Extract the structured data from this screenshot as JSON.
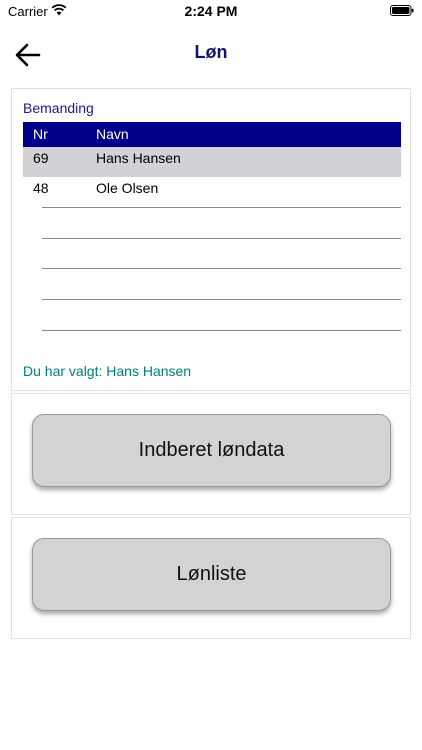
{
  "status_bar": {
    "carrier": "Carrier",
    "time": "2:24 PM",
    "wifi_icon": "wifi-icon",
    "battery_icon": "battery-icon"
  },
  "nav": {
    "title": "Løn",
    "back_icon": "arrow-left-icon"
  },
  "crew": {
    "label": "Bemanding",
    "columns": [
      "Nr",
      "Navn"
    ],
    "rows": [
      {
        "nr": "69",
        "name": "Hans Hansen",
        "selected": true
      },
      {
        "nr": "48",
        "name": "Ole Olsen",
        "selected": false
      }
    ],
    "selected_text": "Du har valgt: Hans Hansen"
  },
  "actions": {
    "report_label": "Indberet løndata",
    "payroll_label": "Lønliste"
  },
  "colors": {
    "title": "#14146e",
    "header_bg": "#00008b",
    "selected_row": "#d2d2d6",
    "selected_text": "#007c7c",
    "button_bg": "#d3d3d3"
  }
}
